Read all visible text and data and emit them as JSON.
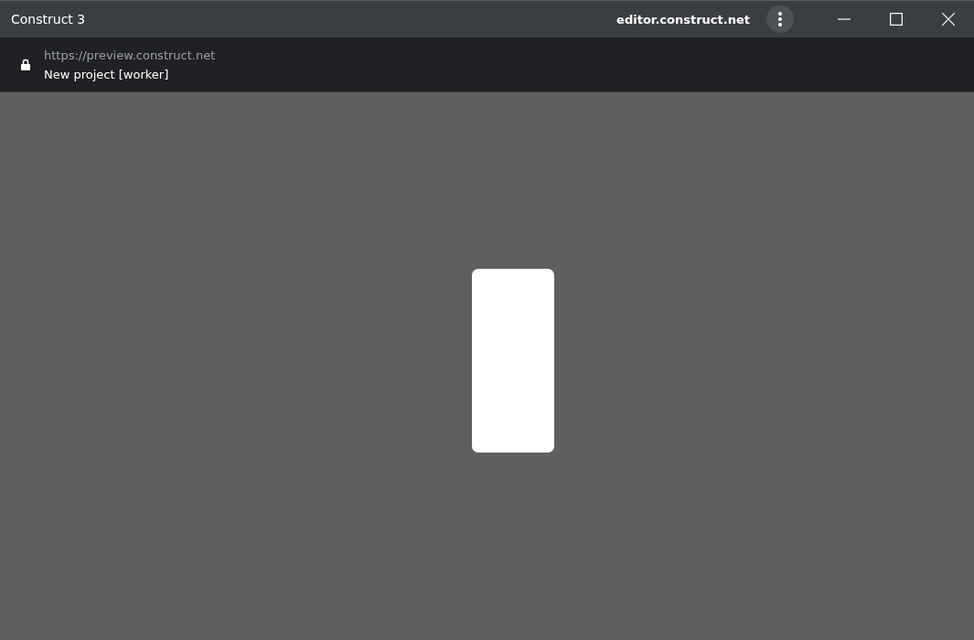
{
  "window": {
    "title": "Construct 3",
    "origin": "editor.construct.net"
  },
  "address_bar": {
    "url": "https://preview.construct.net",
    "page_title": "New project [worker]"
  }
}
